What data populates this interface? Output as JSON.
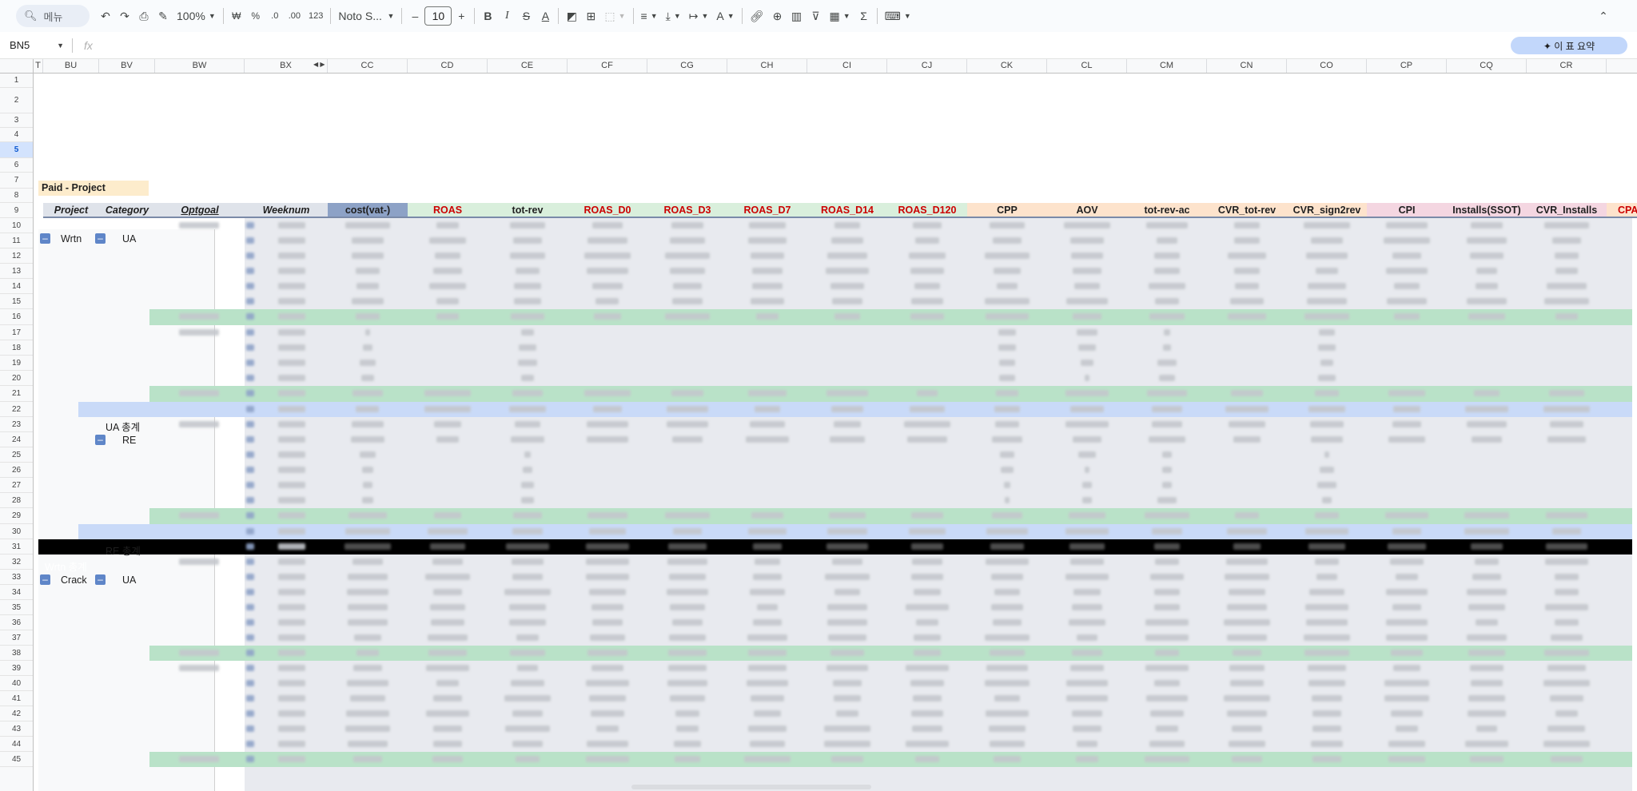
{
  "toolbar": {
    "search_placeholder": "메뉴",
    "zoom": "100%",
    "currency": "₩",
    "percent": "%",
    "dec_minus": ".0",
    "dec_plus": ".00",
    "number_format": "123",
    "font": "Noto S...",
    "font_size": "10",
    "bold": "B",
    "italic": "I",
    "strike": "S",
    "text_color": "A"
  },
  "formula_bar": {
    "name_box": "BN5",
    "fx": "fx",
    "ai_button": "✦ 이 표 요약"
  },
  "columns": [
    "T",
    "BU",
    "BV",
    "BW",
    "BX",
    "CC",
    "CD",
    "CE",
    "CF",
    "CG",
    "CH",
    "CI",
    "CJ",
    "CK",
    "CL",
    "CM",
    "CN",
    "CO",
    "CP",
    "CQ",
    "CR"
  ],
  "rows": [
    "1",
    "2",
    "3",
    "4",
    "5",
    "6",
    "7",
    "8",
    "9",
    "10",
    "11",
    "12",
    "13",
    "14",
    "15",
    "16",
    "17",
    "18",
    "19",
    "20",
    "21",
    "22",
    "23",
    "24",
    "25",
    "26",
    "27",
    "28",
    "29",
    "30",
    "31",
    "32",
    "33",
    "34",
    "35",
    "36",
    "37",
    "38",
    "39",
    "40",
    "41",
    "42",
    "43",
    "44",
    "45"
  ],
  "selected_row": "5",
  "sheet": {
    "section_title": "Paid - Project",
    "headers": {
      "project": "Project",
      "category": "Category",
      "optgoal": "Optgoal",
      "weeknum": "Weeknum",
      "cost": "cost(vat-)",
      "roas": "ROAS",
      "tot_rev": "tot-rev",
      "roas_d0": "ROAS_D0",
      "roas_d3": "ROAS_D3",
      "roas_d7": "ROAS_D7",
      "roas_d14": "ROAS_D14",
      "roas_d120": "ROAS_D120",
      "cpp": "CPP",
      "aov": "AOV",
      "tot_rev_ac": "tot-rev-ac",
      "cvr_tot_rev": "CVR_tot-rev",
      "cvr_sign2rev": "CVR_sign2rev",
      "cpi": "CPI",
      "installs": "Installs(SSOT)",
      "cvr_installs": "CVR_Installs",
      "cpa": "CPA"
    },
    "groups": {
      "wrtn": "Wrtn",
      "ua": "UA",
      "ua_total": "UA 총계",
      "re": "RE",
      "re_total": "RE 총계",
      "wrtn_total": "Wrtn 총계",
      "crack": "Crack",
      "crack_ua": "UA"
    }
  }
}
